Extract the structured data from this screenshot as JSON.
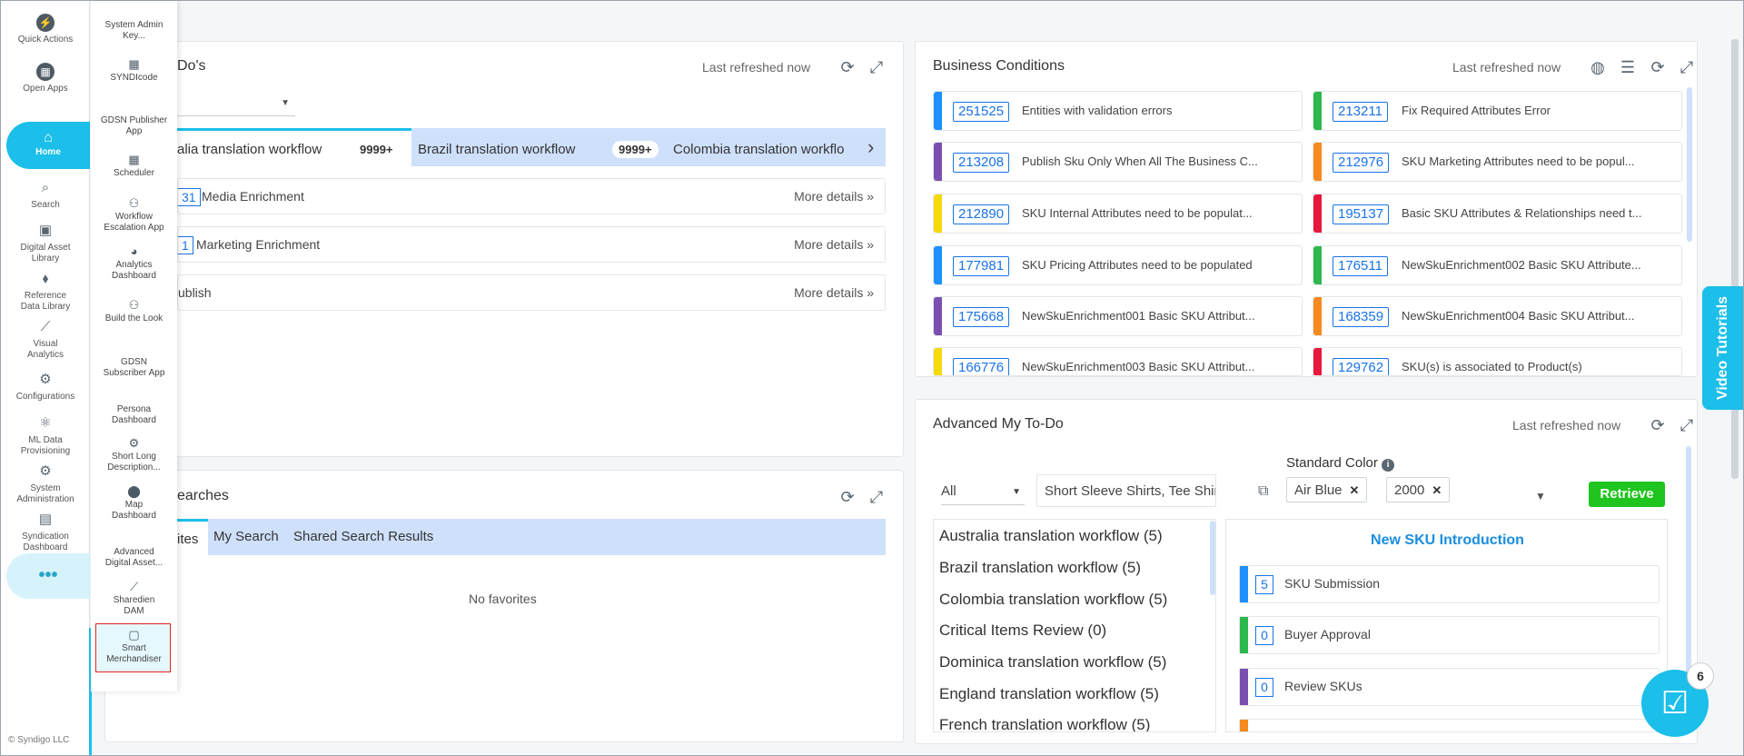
{
  "rail": {
    "items": [
      {
        "label": "Quick Actions",
        "icon": "bolt-icon",
        "glyph": "⚡"
      },
      {
        "label": "Open Apps",
        "icon": "apps-icon",
        "glyph": "▦"
      },
      {
        "label": "Home",
        "icon": "home-icon",
        "glyph": "⌂"
      },
      {
        "label": "Search",
        "icon": "search-icon",
        "glyph": "⌕"
      },
      {
        "label": "Digital Asset Library",
        "icon": "image-icon",
        "glyph": "▣"
      },
      {
        "label": "Reference Data Library",
        "icon": "tag-icon",
        "glyph": "⬧"
      },
      {
        "label": "Visual Analytics",
        "icon": "chart-icon",
        "glyph": "⟋"
      },
      {
        "label": "Configurations",
        "icon": "gear-icon",
        "glyph": "⚙"
      },
      {
        "label": "ML Data Provisioning",
        "icon": "ml-icon",
        "glyph": "⚛"
      },
      {
        "label": "System Administration",
        "icon": "admin-icon",
        "glyph": "⚙"
      },
      {
        "label": "Syndication Dashboard",
        "icon": "dashboard-icon",
        "glyph": "▤"
      }
    ],
    "more": "•••",
    "footer": "© Syndigo LLC"
  },
  "flyout": {
    "items": [
      {
        "label": "System Admin Key...",
        "glyph": ""
      },
      {
        "label": "SYNDIcode",
        "glyph": "▦"
      },
      {
        "label": "GDSN Publisher App",
        "glyph": ""
      },
      {
        "label": "Scheduler",
        "glyph": "▦"
      },
      {
        "label": "Workflow Escalation App",
        "glyph": "⚇"
      },
      {
        "label": "Analytics Dashboard",
        "glyph": "◕"
      },
      {
        "label": "Build the Look",
        "glyph": "⚇"
      },
      {
        "label": "GDSN Subscriber App",
        "glyph": ""
      },
      {
        "label": "Persona Dashboard",
        "glyph": ""
      },
      {
        "label": "Short Long Description...",
        "glyph": "⚙"
      },
      {
        "label": "Map Dashboard",
        "glyph": "⬤"
      },
      {
        "label": "Advanced Digital Asset...",
        "glyph": ""
      },
      {
        "label": "Sharedien DAM",
        "glyph": "⟋"
      },
      {
        "label": "Smart Merchandiser",
        "glyph": "🛍"
      }
    ]
  },
  "todo": {
    "title": "Do's",
    "refreshed": "Last refreshed now",
    "workflows": [
      {
        "label": "alia translation workflow",
        "count": "9999+"
      },
      {
        "label": "Brazil translation workflow",
        "count": "9999+"
      },
      {
        "label": "Colombia translation workflo",
        "count": ""
      }
    ],
    "rows": [
      {
        "num": "31",
        "label": "Media Enrichment",
        "more": "More details »"
      },
      {
        "num": "1",
        "label": "Marketing Enrichment",
        "more": "More details »"
      },
      {
        "num": "",
        "label": "ublish",
        "more": "More details »"
      }
    ]
  },
  "business": {
    "title": "Business Conditions",
    "refreshed": "Last refreshed now",
    "items": [
      {
        "code": "251525",
        "desc": "Entities with validation errors",
        "color": "#1e90ff"
      },
      {
        "code": "213211",
        "desc": "Fix Required Attributes Error",
        "color": "#2db84d"
      },
      {
        "code": "213208",
        "desc": "Publish Sku Only When All The Business C...",
        "color": "#7b4fb0"
      },
      {
        "code": "212976",
        "desc": "SKU Marketing Attributes need to be popul...",
        "color": "#f58a1f"
      },
      {
        "code": "212890",
        "desc": "SKU Internal Attributes need to be populat...",
        "color": "#f5d90a"
      },
      {
        "code": "195137",
        "desc": "Basic SKU Attributes & Relationships need t...",
        "color": "#e8183c"
      },
      {
        "code": "177981",
        "desc": "SKU Pricing Attributes need to be populated",
        "color": "#1e90ff"
      },
      {
        "code": "176511",
        "desc": "NewSkuEnrichment002 Basic SKU Attribute...",
        "color": "#2db84d"
      },
      {
        "code": "175668",
        "desc": "NewSkuEnrichment001 Basic SKU Attribut...",
        "color": "#7b4fb0"
      },
      {
        "code": "168359",
        "desc": "NewSkuEnrichment004 Basic SKU Attribut...",
        "color": "#f58a1f"
      },
      {
        "code": "166776",
        "desc": "NewSkuEnrichment003 Basic SKU Attribut...",
        "color": "#f5d90a"
      },
      {
        "code": "129762",
        "desc": "SKU(s) is associated to Product(s)",
        "color": "#e8183c"
      }
    ]
  },
  "searches": {
    "title": "earches",
    "tabs": [
      "ites",
      "My Search",
      "Shared Search Results"
    ],
    "empty": "No favorites"
  },
  "advanced": {
    "title": "Advanced My To-Do",
    "refreshed": "Last refreshed now",
    "filter_all": "All",
    "filter_type": "Short Sleeve Shirts, Tee Shir...",
    "color_label": "Standard Color",
    "chips": [
      "Air Blue",
      "2000"
    ],
    "retrieve": "Retrieve",
    "workflows": [
      "Australia translation workflow (5)",
      "Brazil translation workflow (5)",
      "Colombia translation workflow (5)",
      "Critical Items Review (0)",
      "Dominica translation workflow (5)",
      "England translation workflow (5)",
      "French translation workflow (5)"
    ],
    "detail_title": "New SKU Introduction",
    "steps": [
      {
        "n": "5",
        "label": "SKU Submission",
        "color": "#1e90ff"
      },
      {
        "n": "0",
        "label": "Buyer Approval",
        "color": "#2db84d"
      },
      {
        "n": "0",
        "label": "Review SKUs",
        "color": "#7b4fb0"
      }
    ]
  },
  "video_tutorials": "Video Tutorials",
  "fab_badge": "6"
}
